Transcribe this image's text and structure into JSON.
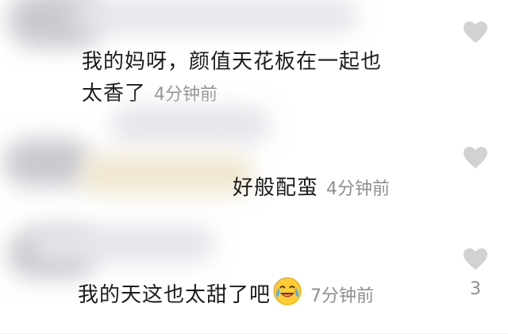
{
  "comments": [
    {
      "line1": "我的妈呀，颜值天花板在一起也",
      "line2": "太香了",
      "time": "4分钟前",
      "like_count": ""
    },
    {
      "text": "好般配蛮",
      "time": "4分钟前",
      "like_count": ""
    },
    {
      "text": "我的天这也太甜了吧",
      "emoji": "laughing-crying-face-icon",
      "time": "7分钟前",
      "like_count": "3"
    }
  ],
  "colors": {
    "text": "#1c1c1c",
    "meta": "#8e8e8e",
    "heart": "#d2d2d2"
  }
}
